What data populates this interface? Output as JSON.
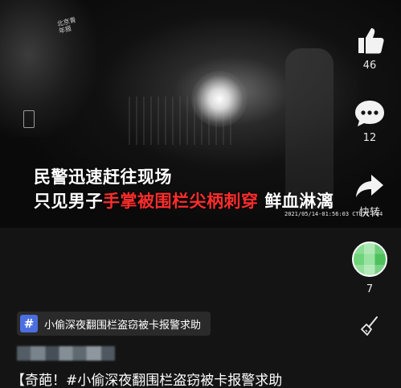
{
  "video": {
    "watermark_logo": "北京青年报",
    "caption_line1": "民警迅速赶往现场",
    "caption_line2_prefix": "只见男子",
    "caption_line2_highlight": "手掌被围栏尖柄刺穿",
    "caption_line2_suffix": "鲜血淋漓",
    "timestamp": "2021/05/14-01:56:03 CTB71 744",
    "highlight_color": "#ff2d2d"
  },
  "rail": {
    "like_count": "46",
    "comment_count": "12",
    "share_label": "快转",
    "follower_count": "7"
  },
  "topic": {
    "label": "小偷深夜翻围栏盗窃被卡报警求助",
    "accent_color": "#4b6fe0"
  },
  "post": {
    "title": "【奇葩！#小偷深夜翻围栏盗窃被卡报警求助"
  }
}
